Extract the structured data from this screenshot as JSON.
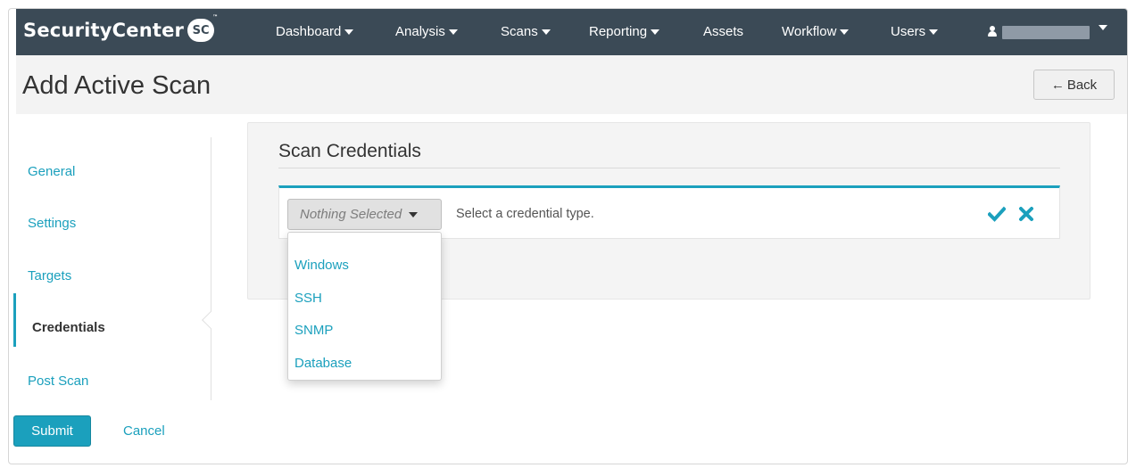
{
  "brand": {
    "name": "SecurityCenter",
    "badge": "SC",
    "trademark": "™"
  },
  "nav": {
    "items": [
      {
        "label": "Dashboard",
        "has_caret": true
      },
      {
        "label": "Analysis",
        "has_caret": true
      },
      {
        "label": "Scans",
        "has_caret": true
      },
      {
        "label": "Reporting",
        "has_caret": true
      },
      {
        "label": "Assets",
        "has_caret": false
      },
      {
        "label": "Workflow",
        "has_caret": true
      },
      {
        "label": "Users",
        "has_caret": true
      }
    ],
    "user_icon": "user-icon"
  },
  "page": {
    "title": "Add Active Scan",
    "back_label": "Back",
    "back_icon": "arrow-left-icon"
  },
  "steps": {
    "items": [
      {
        "label": "General",
        "active": false
      },
      {
        "label": "Settings",
        "active": false
      },
      {
        "label": "Targets",
        "active": false
      },
      {
        "label": "Credentials",
        "active": true
      },
      {
        "label": "Post Scan",
        "active": false
      }
    ]
  },
  "section": {
    "title": "Scan Credentials",
    "select_value": "Nothing Selected",
    "helper_text": "Select a credential type.",
    "options": [
      "Windows",
      "SSH",
      "SNMP",
      "Database"
    ],
    "confirm_icon": "check-icon",
    "cancel_icon": "close-icon"
  },
  "footer": {
    "submit_label": "Submit",
    "cancel_label": "Cancel"
  },
  "colors": {
    "accent": "#1ba0bd",
    "navbar": "#3b4a56",
    "header_bg": "#f3f3f3",
    "panel_bg": "#f4f4f4"
  }
}
